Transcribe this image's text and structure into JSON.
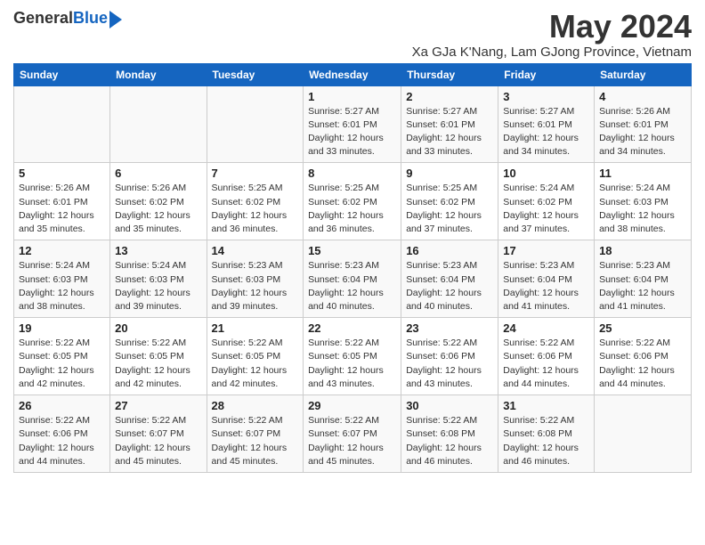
{
  "logo": {
    "general": "General",
    "blue": "Blue"
  },
  "title": {
    "month": "May 2024",
    "location": "Xa GJa K'Nang, Lam GJong Province, Vietnam"
  },
  "headers": [
    "Sunday",
    "Monday",
    "Tuesday",
    "Wednesday",
    "Thursday",
    "Friday",
    "Saturday"
  ],
  "weeks": [
    [
      {
        "day": "",
        "info": ""
      },
      {
        "day": "",
        "info": ""
      },
      {
        "day": "",
        "info": ""
      },
      {
        "day": "1",
        "info": "Sunrise: 5:27 AM\nSunset: 6:01 PM\nDaylight: 12 hours\nand 33 minutes."
      },
      {
        "day": "2",
        "info": "Sunrise: 5:27 AM\nSunset: 6:01 PM\nDaylight: 12 hours\nand 33 minutes."
      },
      {
        "day": "3",
        "info": "Sunrise: 5:27 AM\nSunset: 6:01 PM\nDaylight: 12 hours\nand 34 minutes."
      },
      {
        "day": "4",
        "info": "Sunrise: 5:26 AM\nSunset: 6:01 PM\nDaylight: 12 hours\nand 34 minutes."
      }
    ],
    [
      {
        "day": "5",
        "info": "Sunrise: 5:26 AM\nSunset: 6:01 PM\nDaylight: 12 hours\nand 35 minutes."
      },
      {
        "day": "6",
        "info": "Sunrise: 5:26 AM\nSunset: 6:02 PM\nDaylight: 12 hours\nand 35 minutes."
      },
      {
        "day": "7",
        "info": "Sunrise: 5:25 AM\nSunset: 6:02 PM\nDaylight: 12 hours\nand 36 minutes."
      },
      {
        "day": "8",
        "info": "Sunrise: 5:25 AM\nSunset: 6:02 PM\nDaylight: 12 hours\nand 36 minutes."
      },
      {
        "day": "9",
        "info": "Sunrise: 5:25 AM\nSunset: 6:02 PM\nDaylight: 12 hours\nand 37 minutes."
      },
      {
        "day": "10",
        "info": "Sunrise: 5:24 AM\nSunset: 6:02 PM\nDaylight: 12 hours\nand 37 minutes."
      },
      {
        "day": "11",
        "info": "Sunrise: 5:24 AM\nSunset: 6:03 PM\nDaylight: 12 hours\nand 38 minutes."
      }
    ],
    [
      {
        "day": "12",
        "info": "Sunrise: 5:24 AM\nSunset: 6:03 PM\nDaylight: 12 hours\nand 38 minutes."
      },
      {
        "day": "13",
        "info": "Sunrise: 5:24 AM\nSunset: 6:03 PM\nDaylight: 12 hours\nand 39 minutes."
      },
      {
        "day": "14",
        "info": "Sunrise: 5:23 AM\nSunset: 6:03 PM\nDaylight: 12 hours\nand 39 minutes."
      },
      {
        "day": "15",
        "info": "Sunrise: 5:23 AM\nSunset: 6:04 PM\nDaylight: 12 hours\nand 40 minutes."
      },
      {
        "day": "16",
        "info": "Sunrise: 5:23 AM\nSunset: 6:04 PM\nDaylight: 12 hours\nand 40 minutes."
      },
      {
        "day": "17",
        "info": "Sunrise: 5:23 AM\nSunset: 6:04 PM\nDaylight: 12 hours\nand 41 minutes."
      },
      {
        "day": "18",
        "info": "Sunrise: 5:23 AM\nSunset: 6:04 PM\nDaylight: 12 hours\nand 41 minutes."
      }
    ],
    [
      {
        "day": "19",
        "info": "Sunrise: 5:22 AM\nSunset: 6:05 PM\nDaylight: 12 hours\nand 42 minutes."
      },
      {
        "day": "20",
        "info": "Sunrise: 5:22 AM\nSunset: 6:05 PM\nDaylight: 12 hours\nand 42 minutes."
      },
      {
        "day": "21",
        "info": "Sunrise: 5:22 AM\nSunset: 6:05 PM\nDaylight: 12 hours\nand 42 minutes."
      },
      {
        "day": "22",
        "info": "Sunrise: 5:22 AM\nSunset: 6:05 PM\nDaylight: 12 hours\nand 43 minutes."
      },
      {
        "day": "23",
        "info": "Sunrise: 5:22 AM\nSunset: 6:06 PM\nDaylight: 12 hours\nand 43 minutes."
      },
      {
        "day": "24",
        "info": "Sunrise: 5:22 AM\nSunset: 6:06 PM\nDaylight: 12 hours\nand 44 minutes."
      },
      {
        "day": "25",
        "info": "Sunrise: 5:22 AM\nSunset: 6:06 PM\nDaylight: 12 hours\nand 44 minutes."
      }
    ],
    [
      {
        "day": "26",
        "info": "Sunrise: 5:22 AM\nSunset: 6:06 PM\nDaylight: 12 hours\nand 44 minutes."
      },
      {
        "day": "27",
        "info": "Sunrise: 5:22 AM\nSunset: 6:07 PM\nDaylight: 12 hours\nand 45 minutes."
      },
      {
        "day": "28",
        "info": "Sunrise: 5:22 AM\nSunset: 6:07 PM\nDaylight: 12 hours\nand 45 minutes."
      },
      {
        "day": "29",
        "info": "Sunrise: 5:22 AM\nSunset: 6:07 PM\nDaylight: 12 hours\nand 45 minutes."
      },
      {
        "day": "30",
        "info": "Sunrise: 5:22 AM\nSunset: 6:08 PM\nDaylight: 12 hours\nand 46 minutes."
      },
      {
        "day": "31",
        "info": "Sunrise: 5:22 AM\nSunset: 6:08 PM\nDaylight: 12 hours\nand 46 minutes."
      },
      {
        "day": "",
        "info": ""
      }
    ]
  ]
}
